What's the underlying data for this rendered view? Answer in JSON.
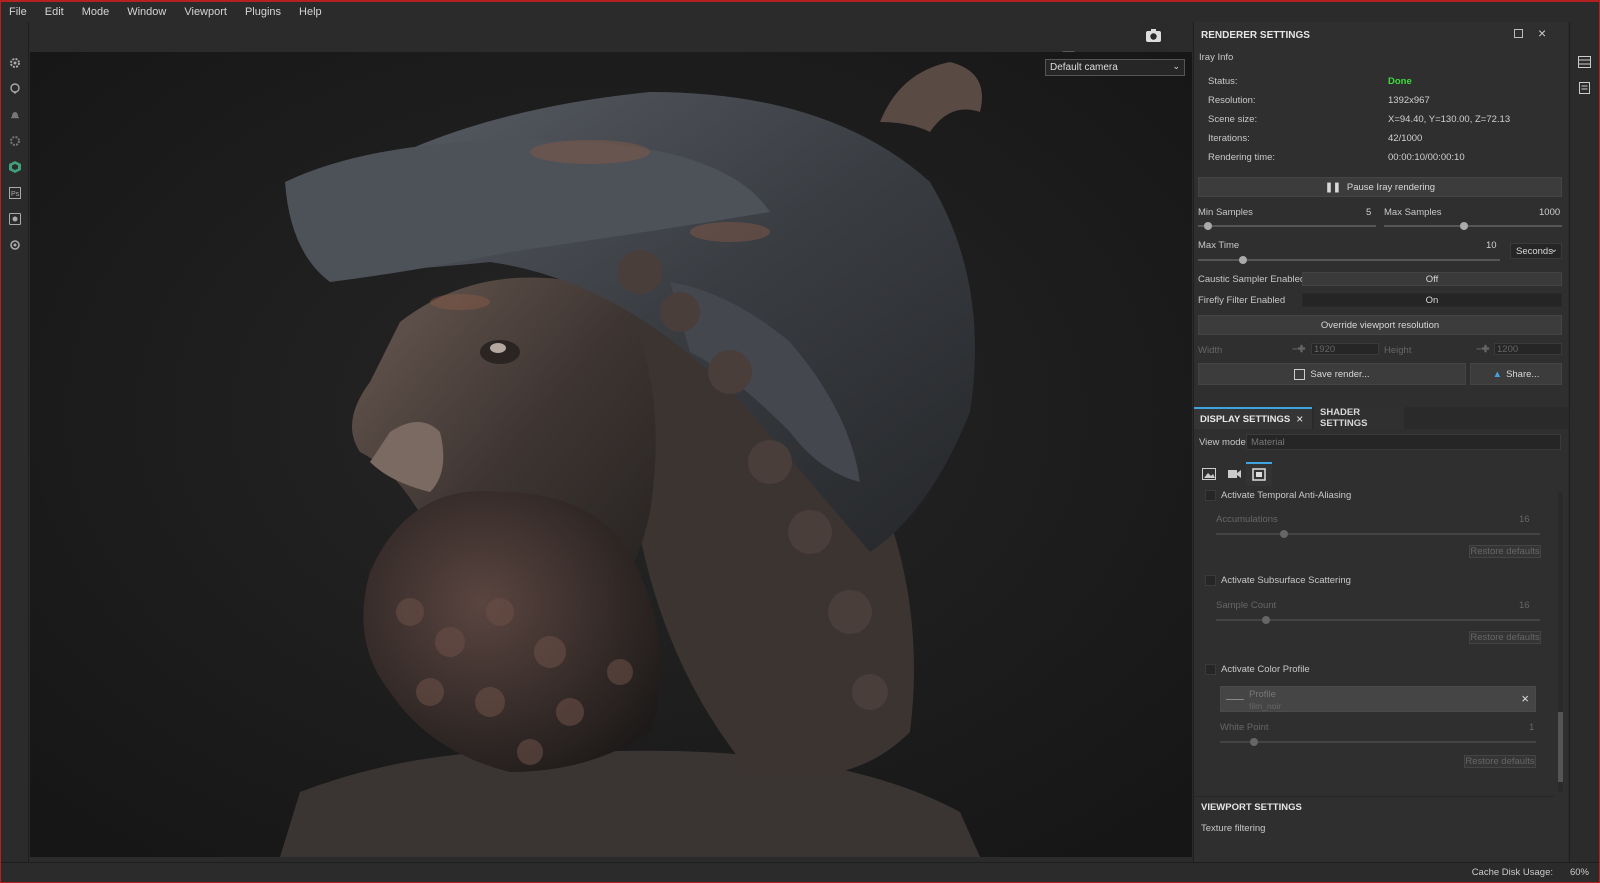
{
  "menu": [
    "File",
    "Edit",
    "Mode",
    "Window",
    "Viewport",
    "Plugins",
    "Help"
  ],
  "left_toolbar_icons": [
    "gear-icon",
    "chat-icon",
    "bell-icon",
    "settings-icon",
    "hexagon-app-icon",
    "photoshop-icon",
    "camera-capture-icon",
    "cog-icon"
  ],
  "viewport": {
    "camera_select": "Default camera",
    "toolbar_icons": [
      "frame-icon",
      "cube-icon",
      "video-camera-icon",
      "camera-icon"
    ]
  },
  "renderer": {
    "title": "RENDERER SETTINGS",
    "section": "Iray Info",
    "info": [
      {
        "label": "Status:",
        "value": "Done"
      },
      {
        "label": "Resolution:",
        "value": "1392x967"
      },
      {
        "label": "Scene size:",
        "value": "X=94.40, Y=130.00, Z=72.13"
      },
      {
        "label": "Iterations:",
        "value": "42/1000"
      },
      {
        "label": "Rendering time:",
        "value": "00:00:10/00:00:10"
      }
    ],
    "pause_label": "Pause Iray rendering",
    "min_samples_label": "Min Samples",
    "min_samples_value": "5",
    "max_samples_label": "Max Samples",
    "max_samples_value": "1000",
    "max_time_label": "Max Time",
    "max_time_value": "10",
    "time_unit": "Seconds",
    "caustic_label": "Caustic Sampler Enabled",
    "caustic_value": "Off",
    "firefly_label": "Firefly Filter Enabled",
    "firefly_value": "On",
    "override_label": "Override viewport resolution",
    "width_label": "Width",
    "width_value": "1920",
    "height_label": "Height",
    "height_value": "1200",
    "save_label": "Save render...",
    "share_label": "Share..."
  },
  "display": {
    "tab_display": "DISPLAY SETTINGS",
    "tab_shader": "SHADER SETTINGS",
    "view_mode_label": "View mode",
    "view_mode_value": "Material",
    "taa_label": "Activate Temporal Anti-Aliasing",
    "accumulations_label": "Accumulations",
    "accumulations_value": "16",
    "restore1": "Restore defaults",
    "sss_label": "Activate Subsurface Scattering",
    "sample_count_label": "Sample Count",
    "sample_count_value": "16",
    "restore2": "Restore defaults",
    "color_profile_label": "Activate Color Profile",
    "profile_label": "Profile",
    "profile_value": "film_noir",
    "white_point_label": "White Point",
    "white_point_value": "1",
    "restore3": "Restore defaults",
    "viewport_settings": "VIEWPORT SETTINGS",
    "texture_filtering": "Texture filtering"
  },
  "status": {
    "cache_label": "Cache Disk Usage:",
    "cache_value": "60%"
  }
}
